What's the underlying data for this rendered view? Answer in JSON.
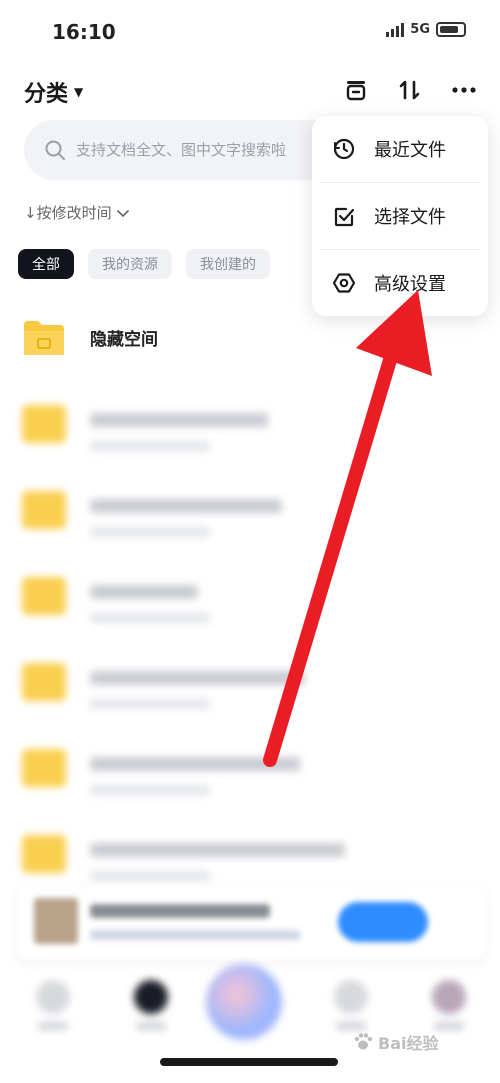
{
  "status_bar": {
    "time": "16:10",
    "network": "5G",
    "icons": [
      "signal-icon",
      "battery-icon"
    ]
  },
  "header": {
    "title": "分类",
    "icons": [
      "archive-icon",
      "sort-icon",
      "more-icon"
    ]
  },
  "search": {
    "placeholder": "支持文档全文、图中文字搜索啦"
  },
  "sort": {
    "label": "↓按修改时间"
  },
  "filter_chips": [
    {
      "label": "全部",
      "active": true
    },
    {
      "label": "我的资源",
      "active": false
    },
    {
      "label": "我创建的",
      "active": false
    }
  ],
  "file_list": {
    "first_folder_name": "隐藏空间"
  },
  "dropdown_menu": {
    "items": [
      {
        "label": "最近文件",
        "icon": "clock-icon"
      },
      {
        "label": "选择文件",
        "icon": "checkbox-icon"
      },
      {
        "label": "高级设置",
        "icon": "settings-icon"
      }
    ]
  },
  "colors": {
    "folder": "#f8c840",
    "arrow": "#ea1c24",
    "active_chip": "#11141c",
    "promo_button": "#2f8cff"
  },
  "watermark": {
    "text": "Bai经验"
  }
}
